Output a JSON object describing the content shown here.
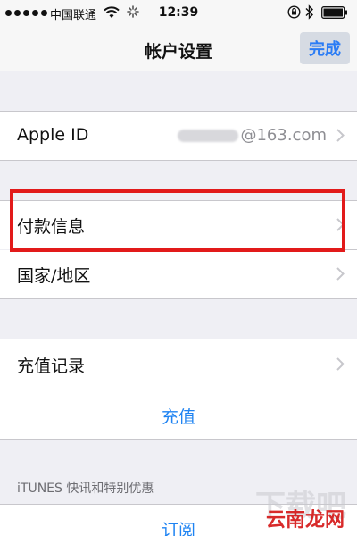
{
  "status_bar": {
    "carrier": "中国联通",
    "time": "12:39"
  },
  "nav": {
    "title": "帐户设置",
    "done_label": "完成"
  },
  "apple_id": {
    "label": "Apple ID",
    "value_suffix": "@163.com"
  },
  "payment": {
    "label": "付款信息"
  },
  "region": {
    "label": "国家/地区"
  },
  "recharge_history": {
    "label": "充值记录"
  },
  "recharge": {
    "label": "充值"
  },
  "itunes_section": {
    "header": "iTUNES 快讯和特别优惠"
  },
  "subscribe": {
    "label": "订阅"
  },
  "watermark": {
    "text": "云南龙网"
  },
  "colors": {
    "accent": "#1e83f2",
    "highlight": "#e21a1a",
    "background": "#efeff4"
  }
}
